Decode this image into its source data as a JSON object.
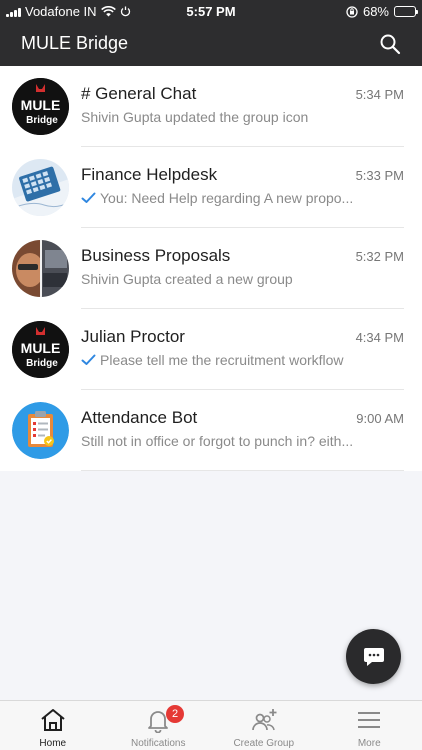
{
  "status_bar": {
    "carrier": "Vodafone IN",
    "time": "5:57 PM",
    "battery": "68%",
    "battery_level": 0.68
  },
  "app_bar": {
    "title": "MULE Bridge",
    "search_icon": "search-icon"
  },
  "chats": [
    {
      "title": "# General Chat",
      "time": "5:34 PM",
      "preview": "Shivin Gupta updated the group icon",
      "sent_tick": false,
      "avatar": "mule-bridge-logo",
      "avatar_text_1": "MULE",
      "avatar_text_2": "Bridge"
    },
    {
      "title": "Finance Helpdesk",
      "time": "5:33 PM",
      "preview": "You: Need Help regarding A new propo...",
      "sent_tick": true,
      "avatar": "calculator-image"
    },
    {
      "title": "Business Proposals",
      "time": "5:32 PM",
      "preview": "Shivin Gupta created a new group",
      "sent_tick": false,
      "avatar": "photo-collage"
    },
    {
      "title": "Julian Proctor",
      "time": "4:34 PM",
      "preview": "Please tell me the recruitment workflow",
      "sent_tick": true,
      "avatar": "mule-bridge-logo",
      "avatar_text_1": "MULE",
      "avatar_text_2": "Bridge"
    },
    {
      "title": "Attendance Bot",
      "time": "9:00 AM",
      "preview": "Still not in office or forgot to punch in? eith...",
      "sent_tick": false,
      "avatar": "clipboard-icon"
    }
  ],
  "fab": {
    "icon": "chat-bubble-icon"
  },
  "tabs": [
    {
      "label": "Home",
      "icon": "home-icon",
      "active": true
    },
    {
      "label": "Notifications",
      "icon": "bell-icon",
      "badge": "2"
    },
    {
      "label": "Create Group",
      "icon": "add-group-icon"
    },
    {
      "label": "More",
      "icon": "menu-icon"
    }
  ],
  "colors": {
    "bar_background": "#2d2d2f",
    "tick_blue": "#2f87e0",
    "badge_red": "#e53935",
    "logo_red": "#d32f2f",
    "clipboard_blue": "#2f9be6"
  }
}
